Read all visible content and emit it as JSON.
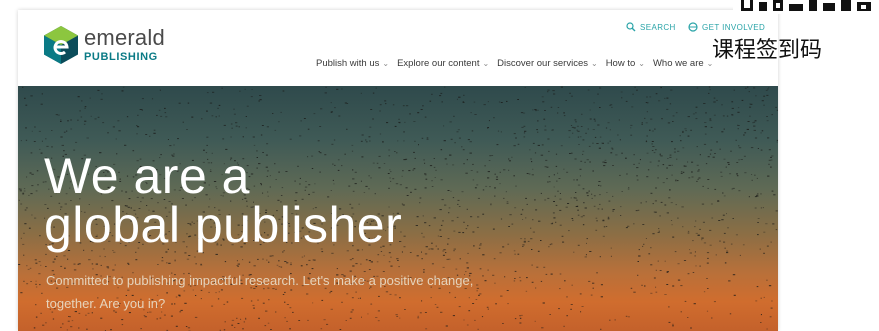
{
  "brand": {
    "name": "emerald",
    "sub": "PUBLISHING",
    "colors": {
      "green": "#8cc63f",
      "teal": "#0a7a85",
      "dark_teal": "#0b4c5a"
    }
  },
  "utility": {
    "search_label": "SEARCH",
    "search_icon": "search-icon",
    "account_label": "GET INVOLVED",
    "account_icon": "user-icon"
  },
  "nav": {
    "items": [
      {
        "label": "Publish with us"
      },
      {
        "label": "Explore our content"
      },
      {
        "label": "Discover our services"
      },
      {
        "label": "How to"
      },
      {
        "label": "Who we are"
      }
    ]
  },
  "hero": {
    "title_line1": "We are a",
    "title_line2": "global publisher",
    "subtitle": "Committed to publishing impactful research. Let's make a positive change, together. Are you in?"
  },
  "overlay": {
    "text": "课程签到码"
  }
}
